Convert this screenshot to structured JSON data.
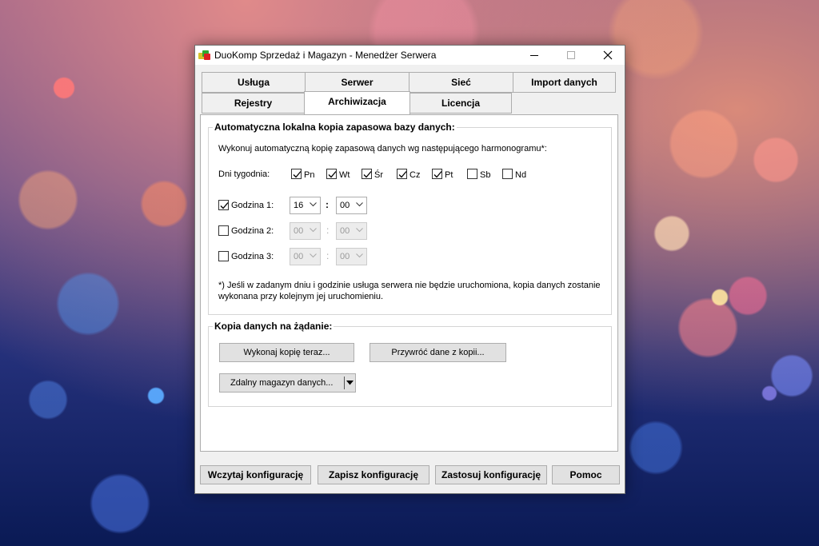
{
  "window": {
    "title": "DuoKomp Sprzedaż i Magazyn - Menedżer Serwera"
  },
  "tabs": {
    "back_row": [
      "Usługa",
      "Serwer",
      "Sieć",
      "Import danych"
    ],
    "front_row": [
      "Rejestry",
      "Archiwizacja",
      "Licencja"
    ],
    "active": "Archiwizacja"
  },
  "auto_backup": {
    "group_title": "Automatyczna lokalna kopia zapasowa bazy danych:",
    "description": "Wykonuj automatyczną kopię zapasową danych wg następującego harmonogramu*:",
    "days_label": "Dni tygodnia:",
    "days": [
      {
        "label": "Pn",
        "checked": true
      },
      {
        "label": "Wt",
        "checked": true
      },
      {
        "label": "Śr",
        "checked": true
      },
      {
        "label": "Cz",
        "checked": true
      },
      {
        "label": "Pt",
        "checked": true
      },
      {
        "label": "Sb",
        "checked": false
      },
      {
        "label": "Nd",
        "checked": false
      }
    ],
    "times": [
      {
        "label": "Godzina 1:",
        "checked": true,
        "hour": "16",
        "minute": "00",
        "enabled": true
      },
      {
        "label": "Godzina 2:",
        "checked": false,
        "hour": "00",
        "minute": "00",
        "enabled": false
      },
      {
        "label": "Godzina 3:",
        "checked": false,
        "hour": "00",
        "minute": "00",
        "enabled": false
      }
    ],
    "time_separator": ":",
    "footnote_line1": "*) Jeśli w zadanym dniu i godzinie usługa serwera nie będzie uruchomiona, kopia danych zostanie",
    "footnote_line2": "wykonana przy kolejnym jej uruchomieniu."
  },
  "on_demand": {
    "group_title": "Kopia danych na żądanie:",
    "backup_now": "Wykonaj kopię teraz...",
    "restore": "Przywróć dane z kopii...",
    "remote_storage": "Zdalny magazyn danych..."
  },
  "footer": {
    "load": "Wczytaj konfigurację",
    "save": "Zapisz konfigurację",
    "apply": "Zastosuj konfigurację",
    "help": "Pomoc"
  }
}
